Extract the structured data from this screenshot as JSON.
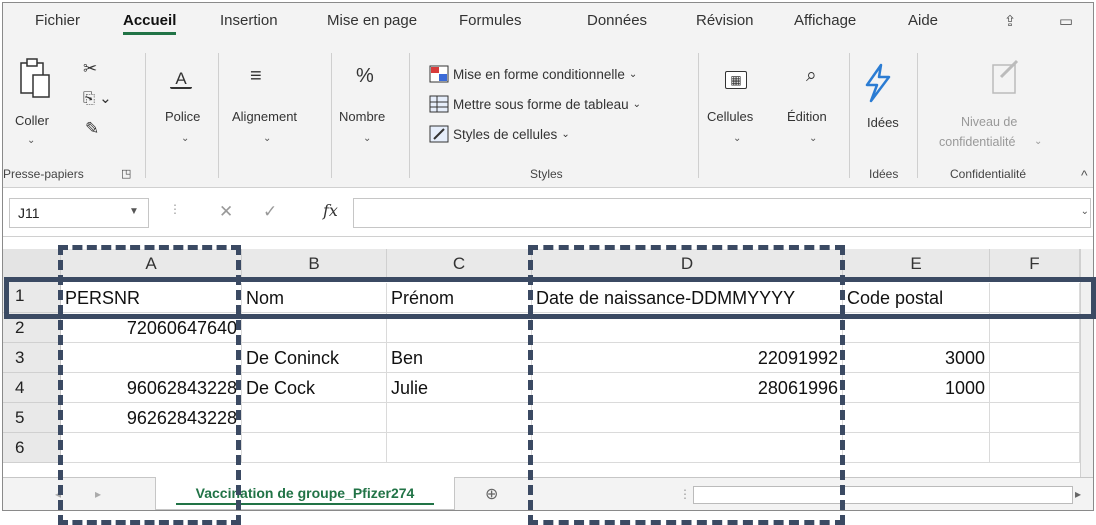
{
  "ribbon_tabs": [
    "Fichier",
    "Accueil",
    "Insertion",
    "Mise en page",
    "Formules",
    "Données",
    "Révision",
    "Affichage",
    "Aide"
  ],
  "active_tab": "Accueil",
  "clipboard": {
    "paste": "Coller",
    "group": "Presse-papiers"
  },
  "font": {
    "label": "Police"
  },
  "alignment": {
    "label": "Alignement"
  },
  "number": {
    "label": "Nombre",
    "symbol": "%"
  },
  "styles": {
    "conditional": "Mise en forme conditionnelle",
    "table": "Mettre sous forme de tableau",
    "cell_styles": "Styles de cellules",
    "group": "Styles"
  },
  "cells_group": {
    "label": "Cellules"
  },
  "editing": {
    "label": "Édition"
  },
  "ideas": {
    "label": "Idées",
    "group": "Idées"
  },
  "sensitivity": {
    "line1": "Niveau de",
    "line2": "confidentialité",
    "group": "Confidentialité"
  },
  "formula_bar": {
    "name_box": "J11",
    "fx": "fx",
    "value": ""
  },
  "columns": [
    "A",
    "B",
    "C",
    "D",
    "E",
    "F"
  ],
  "rows": [
    {
      "num": "1",
      "A": "PERSNR",
      "B": "Nom",
      "C": "Prénom",
      "D": "Date de naissance-DDMMYYYY",
      "E": "Code postal",
      "F": ""
    },
    {
      "num": "2",
      "A": "72060647640",
      "B": "",
      "C": "",
      "D": "",
      "E": "",
      "F": ""
    },
    {
      "num": "3",
      "A": "",
      "B": "De Coninck",
      "C": "Ben",
      "D": "22091992",
      "E": "3000",
      "F": ""
    },
    {
      "num": "4",
      "A": "96062843228",
      "B": "De Cock",
      "C": "Julie",
      "D": "28061996",
      "E": "1000",
      "F": ""
    },
    {
      "num": "5",
      "A": "96262843228",
      "B": "",
      "C": "",
      "D": "",
      "E": "",
      "F": ""
    },
    {
      "num": "6",
      "A": "",
      "B": "",
      "C": "",
      "D": "",
      "E": "",
      "F": ""
    }
  ],
  "sheet_tab": "Vaccination de groupe_Pfizer274",
  "colors": {
    "accent": "#217346",
    "annotation": "#3b4a63"
  }
}
